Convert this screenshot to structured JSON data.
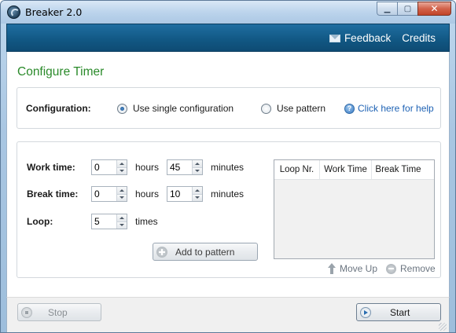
{
  "window": {
    "title": "Breaker 2.0"
  },
  "header": {
    "feedback_label": "Feedback",
    "credits_label": "Credits"
  },
  "main": {
    "section_title": "Configure Timer",
    "configuration": {
      "label": "Configuration:",
      "option_single": "Use single configuration",
      "option_pattern": "Use pattern",
      "selected": "single",
      "help_link": "Click here for help"
    },
    "work_time": {
      "label": "Work time:",
      "hours": "0",
      "minutes": "45"
    },
    "break_time": {
      "label": "Break time:",
      "hours": "0",
      "minutes": "10"
    },
    "loop": {
      "label": "Loop:",
      "value": "5",
      "unit": "times"
    },
    "units": {
      "hours": "hours",
      "minutes": "minutes"
    },
    "add_to_pattern_label": "Add to pattern",
    "pattern_table": {
      "columns": [
        "Loop Nr.",
        "Work Time",
        "Break Time"
      ],
      "rows": []
    },
    "move_up_label": "Move Up",
    "remove_label": "Remove"
  },
  "footer": {
    "stop_label": "Stop",
    "start_label": "Start"
  },
  "colors": {
    "accent_green": "#2a8a2a",
    "header_blue": "#115783",
    "link_blue": "#1e62b4"
  }
}
